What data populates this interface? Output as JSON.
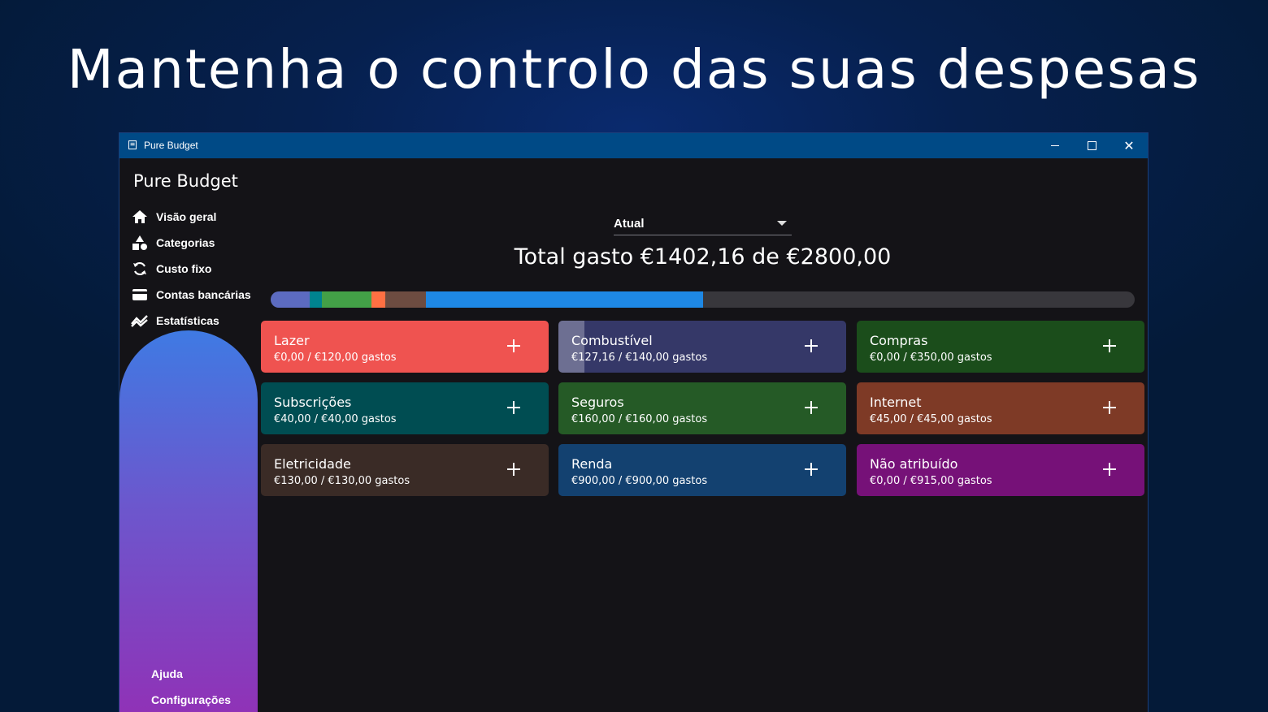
{
  "headline": "Mantenha o controlo das suas despesas",
  "window": {
    "title": "Pure Budget",
    "controls": {
      "minimize": "minimize-icon",
      "maximize": "maximize-icon",
      "close": "close-icon"
    }
  },
  "sidebar": {
    "brand": "Pure Budget",
    "items": [
      {
        "label": "Visão geral",
        "icon": "home-icon"
      },
      {
        "label": "Categorias",
        "icon": "shapes-icon"
      },
      {
        "label": "Custo fixo",
        "icon": "refresh-icon"
      },
      {
        "label": "Contas bancárias",
        "icon": "credit-card-icon"
      },
      {
        "label": "Estatísticas",
        "icon": "chart-line-icon"
      }
    ],
    "footer": [
      {
        "label": "Ajuda"
      },
      {
        "label": "Configurações"
      }
    ],
    "gradient": [
      "#3f7ae3",
      "#6c57cd",
      "#9131b6"
    ]
  },
  "main": {
    "period_select": {
      "value": "Atual"
    },
    "total_text": "Total gasto €1402,16 de €2800,00",
    "budget_bar": {
      "total": 2800,
      "track_color": "#38373c",
      "segments": [
        {
          "value": 127.16,
          "color": "#5c6bc0"
        },
        {
          "value": 40,
          "color": "#00838f"
        },
        {
          "value": 160,
          "color": "#43a047"
        },
        {
          "value": 45,
          "color": "#ff7043"
        },
        {
          "value": 130,
          "color": "#6d4c41"
        },
        {
          "value": 900,
          "color": "#1e88e5"
        }
      ]
    },
    "categories": [
      {
        "name": "Lazer",
        "spent": "€0,00 / €120,00 gastos",
        "fill_fraction": 0.0,
        "color": "#ef5350"
      },
      {
        "name": "Combustível",
        "spent": "€127,16 / €140,00 gastos",
        "fill_fraction": 0.09,
        "color": "#353868"
      },
      {
        "name": "Compras",
        "spent": "€0,00 / €350,00 gastos",
        "fill_fraction": 0.0,
        "color": "#1b4d1b"
      },
      {
        "name": "Subscrições",
        "spent": "€40,00 / €40,00 gastos",
        "fill_fraction": 0.0,
        "color": "#004d52"
      },
      {
        "name": "Seguros",
        "spent": "€160,00 / €160,00 gastos",
        "fill_fraction": 0.0,
        "color": "#255a26"
      },
      {
        "name": "Internet",
        "spent": "€45,00 / €45,00 gastos",
        "fill_fraction": 0.0,
        "color": "#7e3a26"
      },
      {
        "name": "Eletricidade",
        "spent": "€130,00 / €130,00 gastos",
        "fill_fraction": 0.0,
        "color": "#3a2b26"
      },
      {
        "name": "Renda",
        "spent": "€900,00 / €900,00 gastos",
        "fill_fraction": 0.0,
        "color": "#134170"
      },
      {
        "name": "Não atribuído",
        "spent": "€0,00 / €915,00 gastos",
        "fill_fraction": 0.0,
        "color": "#761178"
      }
    ],
    "add_icon": "plus-icon"
  }
}
